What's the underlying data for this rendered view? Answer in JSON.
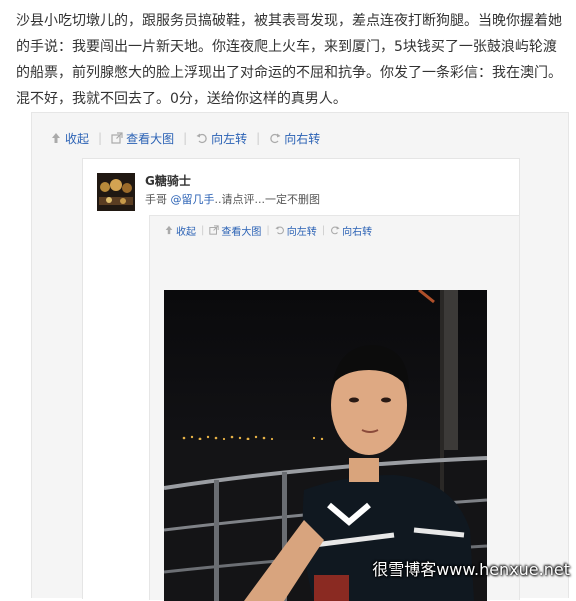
{
  "post": {
    "text": "沙县小吃切墩儿的，跟服务员搞破鞋，被其表哥发现，差点连夜打断狗腿。当晚你握着她的手说：我要闯出一片新天地。你连夜爬上火车，来到厦门，5块钱买了一张鼓浪屿轮渡的船票，前列腺憋大的脸上浮现出了对命运的不屈和抗争。你发了一条彩信：我在澳门。混不好，我就不回去了。0分，送给你这样的真男人。"
  },
  "outer_toolbar": {
    "collapse": "收起",
    "view_large": "查看大图",
    "rotate_left": "向左转",
    "rotate_right": "向右转"
  },
  "repost": {
    "username": "G糖骑士",
    "text_prefix": "手哥 ",
    "mention": "@留几手",
    "text_suffix": "..请点评...一定不删图"
  },
  "inner_toolbar": {
    "collapse": "收起",
    "view_large": "查看大图",
    "rotate_left": "向左转",
    "rotate_right": "向右转"
  },
  "watermark": "很雪博客www.henxue.net",
  "icons": {
    "collapse": "up-arrow-icon",
    "view_large": "external-link-icon",
    "rotate_left": "rotate-left-icon",
    "rotate_right": "rotate-right-icon"
  },
  "colors": {
    "link": "#2b62b5",
    "text": "#333333",
    "panel_bg": "#f5f5f5",
    "border": "#e6e6e6"
  }
}
